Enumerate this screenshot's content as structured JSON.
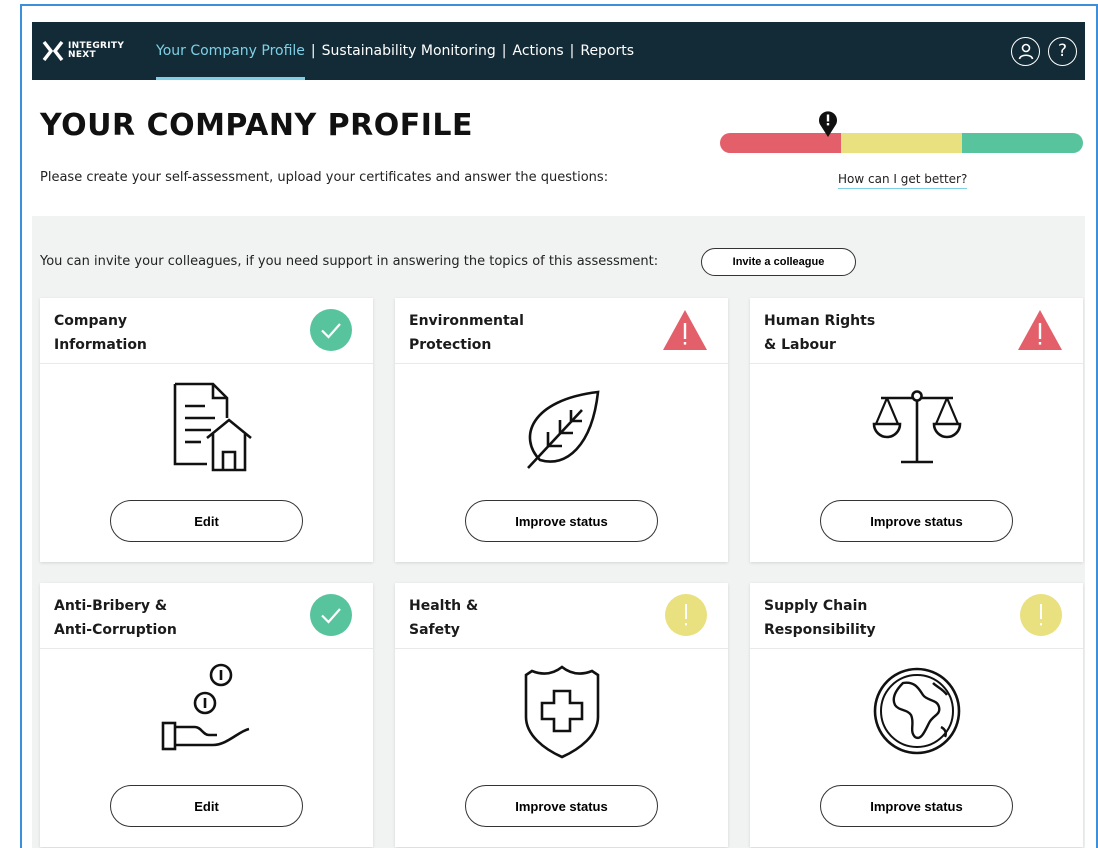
{
  "nav": {
    "logo_line1": "INTEGRITY",
    "logo_line2": "NEXT",
    "links": [
      {
        "label": "Your Company Profile"
      },
      {
        "label": "Sustainability Monitoring"
      },
      {
        "label": "Actions"
      },
      {
        "label": "Reports"
      }
    ],
    "separator": "|",
    "help_glyph": "?"
  },
  "header": {
    "title": "YOUR COMPANY PROFILE",
    "subtitle": "Please create your self-assessment, upload your certificates and answer the questions:",
    "better_link": "How can I get better?",
    "colors": {
      "red": "#e35f69",
      "yellow": "#e9e07f",
      "green": "#58c49d"
    }
  },
  "invite": {
    "text": "You can invite your colleagues, if you need support in answering the topics of this assessment:",
    "button": "Invite a colleague"
  },
  "cards": [
    {
      "line1": "Company",
      "line2": "Information",
      "status": "complete",
      "status_icon": "check-icon",
      "illustration": "document-house-icon",
      "button": "Edit"
    },
    {
      "line1": "Environmental",
      "line2": "Protection",
      "status": "critical",
      "status_icon": "warning-triangle-icon",
      "illustration": "leaf-icon",
      "button": "Improve status"
    },
    {
      "line1": "Human Rights",
      "line2": "& Labour",
      "status": "critical",
      "status_icon": "warning-triangle-icon",
      "illustration": "scales-icon",
      "button": "Improve status"
    },
    {
      "line1": "Anti-Bribery &",
      "line2": "Anti-Corruption",
      "status": "complete",
      "status_icon": "check-icon",
      "illustration": "hand-coins-icon",
      "button": "Edit"
    },
    {
      "line1": "Health &",
      "line2": "Safety",
      "status": "attention",
      "status_icon": "exclamation-icon",
      "illustration": "shield-cross-icon",
      "button": "Improve status"
    },
    {
      "line1": "Supply Chain",
      "line2": "Responsibility",
      "status": "attention",
      "status_icon": "exclamation-icon",
      "illustration": "globe-icon",
      "button": "Improve status"
    }
  ]
}
